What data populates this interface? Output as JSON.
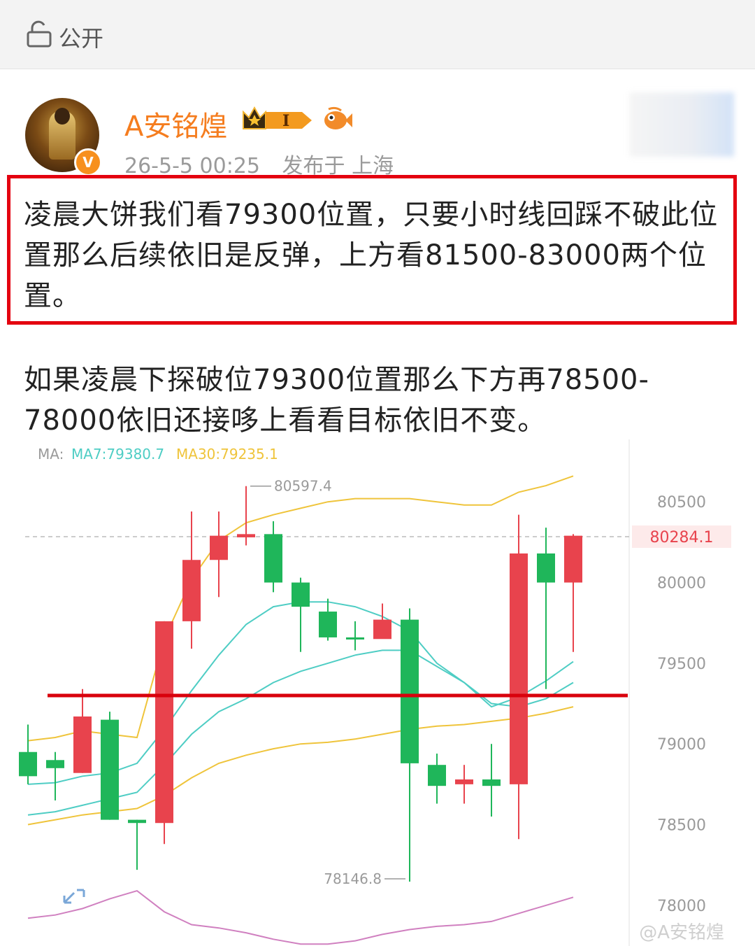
{
  "top_bar": {
    "visibility_label": "公开",
    "icon": "lock-open-icon"
  },
  "author": {
    "name": "A安铭煌",
    "verified_badge": "V",
    "timestamp": "26-5-5 00:25",
    "location": "发布于 上海",
    "badge_level": "I"
  },
  "post": {
    "paragraph_1": "凌晨大饼我们看79300位置，只要小时线回踩不破此位置那么后续依旧是反弹，上方看81500-83000两个位置。",
    "paragraph_2": "如果凌晨下探破位79300位置那么下方再78500-78000依旧还接哆上看看目标依旧不变。",
    "highlight_color": "#e4000f"
  },
  "watermark": "@A安铭煌",
  "chart_data": {
    "type": "candlestick",
    "ma_legend": {
      "prefix": "MA:",
      "ma7_label": "MA7:79380.7",
      "ma30_label": "MA30:79235.1"
    },
    "y_ticks": [
      "80500",
      "80000",
      "79500",
      "79000",
      "78500",
      "78000"
    ],
    "y_tick_values": [
      80500,
      80000,
      79500,
      79000,
      78500,
      78000
    ],
    "ylim": [
      77800,
      80800
    ],
    "current_price_label": "80284.1",
    "current_price": 80284.1,
    "high_annotation": "80597.4",
    "low_annotation": "78146.8",
    "support_line": 79300,
    "colors": {
      "up": "#e8434d",
      "down": "#1fb65a",
      "ma7": "#4ecdc4",
      "ma30": "#efc43b",
      "support": "#d9000c",
      "extra_ma": "#d080c0",
      "boll_upper": "#efc43b"
    },
    "candles": [
      {
        "o": 78950,
        "c": 78800,
        "h": 79120,
        "l": 78750
      },
      {
        "o": 78900,
        "c": 78850,
        "h": 78950,
        "l": 78650
      },
      {
        "o": 78820,
        "c": 79170,
        "h": 79340,
        "l": 78820
      },
      {
        "o": 79150,
        "c": 78530,
        "h": 79200,
        "l": 78530
      },
      {
        "o": 78530,
        "c": 78510,
        "h": 78530,
        "l": 78220
      },
      {
        "o": 78510,
        "c": 79760,
        "h": 79760,
        "l": 78380
      },
      {
        "o": 79760,
        "c": 80140,
        "h": 80440,
        "l": 79590
      },
      {
        "o": 80140,
        "c": 80290,
        "h": 80440,
        "l": 79910
      },
      {
        "o": 80280,
        "c": 80300,
        "h": 80597.4,
        "l": 80230
      },
      {
        "o": 80300,
        "c": 80000,
        "h": 80380,
        "l": 79940
      },
      {
        "o": 80000,
        "c": 79850,
        "h": 80030,
        "l": 79570
      },
      {
        "o": 79820,
        "c": 79660,
        "h": 79900,
        "l": 79640
      },
      {
        "o": 79660,
        "c": 79650,
        "h": 79760,
        "l": 79580
      },
      {
        "o": 79650,
        "c": 79770,
        "h": 79870,
        "l": 79660
      },
      {
        "o": 79770,
        "c": 78880,
        "h": 79840,
        "l": 78146.8
      },
      {
        "o": 78870,
        "c": 78740,
        "h": 78940,
        "l": 78630
      },
      {
        "o": 78750,
        "c": 78780,
        "h": 78870,
        "l": 78630
      },
      {
        "o": 78780,
        "c": 78740,
        "h": 79000,
        "l": 78550
      },
      {
        "o": 78750,
        "c": 80180,
        "h": 80420,
        "l": 78410
      },
      {
        "o": 80180,
        "c": 80000,
        "h": 80340,
        "l": 79340
      },
      {
        "o": 80000,
        "c": 80290,
        "h": 80300,
        "l": 79570
      }
    ],
    "ma7": [
      78750,
      78760,
      78800,
      78820,
      78880,
      79090,
      79330,
      79550,
      79740,
      79850,
      79880,
      79880,
      79850,
      79790,
      79700,
      79500,
      79380,
      79230,
      79290,
      79390,
      79510
    ],
    "ma30": [
      78560,
      78580,
      78620,
      78660,
      78700,
      78870,
      79060,
      79200,
      79280,
      79380,
      79450,
      79500,
      79550,
      79580,
      79580,
      79480,
      79380,
      79250,
      79230,
      79280,
      79380
    ],
    "mid": [
      78500,
      78530,
      78560,
      78580,
      78600,
      78680,
      78790,
      78880,
      78930,
      78970,
      79000,
      79010,
      79030,
      79060,
      79090,
      79110,
      79120,
      79140,
      79160,
      79190,
      79230
    ],
    "upper": [
      79020,
      79040,
      79080,
      79060,
      79040,
      79650,
      80020,
      80260,
      80370,
      80420,
      80460,
      80500,
      80520,
      80520,
      80520,
      80500,
      80480,
      80480,
      80560,
      80600,
      80660
    ],
    "lower": [
      77920,
      77940,
      77980,
      78040,
      78090,
      77960,
      77880,
      77860,
      77830,
      77790,
      77760,
      77760,
      77780,
      77820,
      77850,
      77870,
      77880,
      77900,
      77950,
      78000,
      78050
    ]
  }
}
